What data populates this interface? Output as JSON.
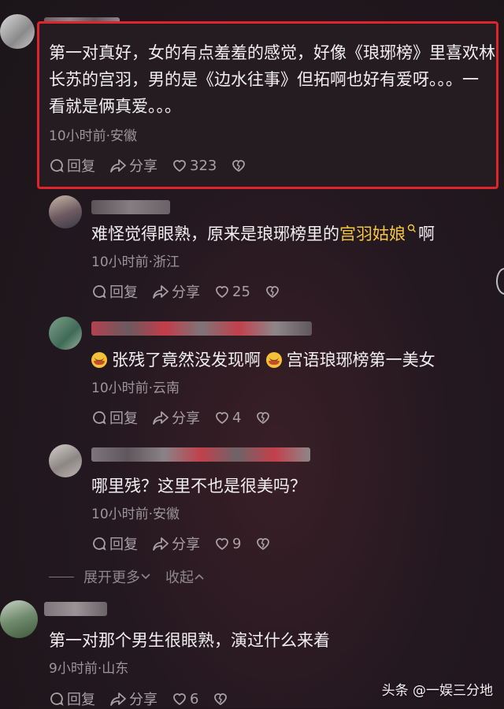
{
  "comments": [
    {
      "text_lines": [
        "第一对真好，女的有点羞羞的感觉，好像《琅琊榜》里喜欢林",
        "长苏的宫羽，男的是《边水往事》但拓啊也好有爱呀。。。一",
        "看就是俩真爱。。。"
      ],
      "meta": "10小时前·安徽",
      "reply": "回复",
      "share": "分享",
      "likes": "323"
    },
    {
      "text_before": "难怪觉得眼熟，原来是琅琊榜里的",
      "link_text": "宫羽姑娘",
      "text_after": "啊",
      "meta": "10小时前·浙江",
      "reply": "回复",
      "share": "分享",
      "likes": "25"
    },
    {
      "text_part1": "张残了竟然没发现啊",
      "text_part2": "宫语琅琊榜第一美女",
      "meta": "10小时前·云南",
      "reply": "回复",
      "share": "分享",
      "likes": "4"
    },
    {
      "text": "哪里残？这里不也是很美吗？",
      "meta": "10小时前·安徽",
      "reply": "回复",
      "share": "分享",
      "likes": "9"
    },
    {
      "text": "第一对那个男生很眼熟，演过什么来着",
      "meta": "9小时前·山东",
      "reply": "回复",
      "share": "分享",
      "likes": "6"
    }
  ],
  "expand": {
    "more": "展开更多",
    "collapse": "收起"
  },
  "watermark": "头条 @一娱三分地",
  "colors": {
    "highlight_border": "#e0242c",
    "link": "#f2c744"
  }
}
